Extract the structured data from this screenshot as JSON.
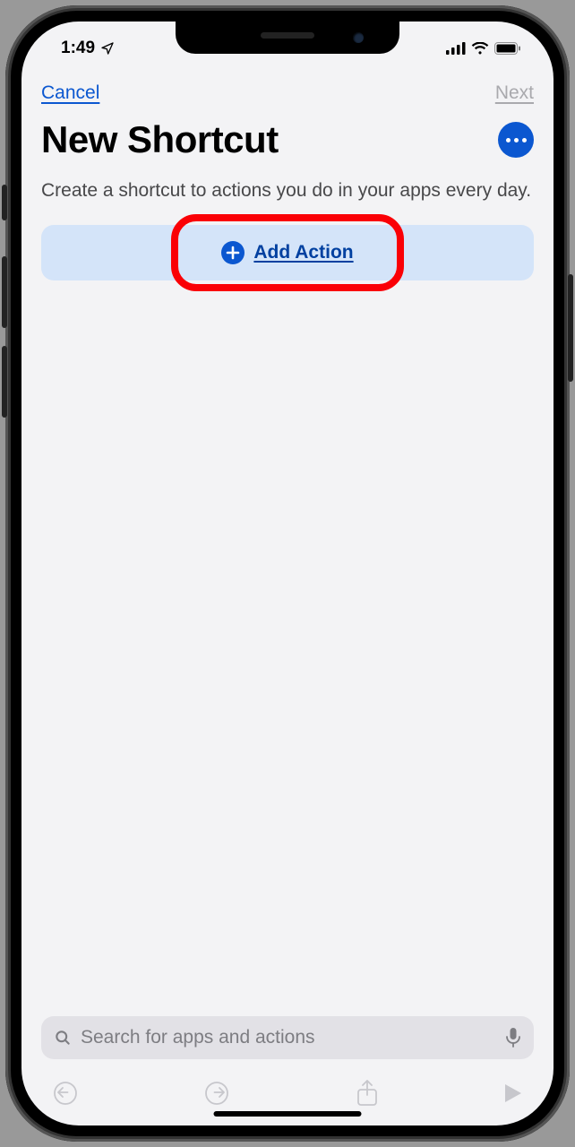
{
  "status": {
    "time": "1:49",
    "location_icon": "location-arrow"
  },
  "nav": {
    "cancel": "Cancel",
    "next": "Next"
  },
  "header": {
    "title": "New Shortcut",
    "subtitle": "Create a shortcut to actions you do in your apps every day."
  },
  "main": {
    "add_action_label": "Add Action"
  },
  "search": {
    "placeholder": "Search for apps and actions"
  },
  "icons": {
    "search": "search-icon",
    "mic": "microphone-icon",
    "undo": "undo-icon",
    "redo": "redo-icon",
    "share": "share-icon",
    "play": "play-icon",
    "more": "ellipsis-icon",
    "plus": "plus-icon",
    "signal": "cellular-signal-icon",
    "wifi": "wifi-icon",
    "battery": "battery-icon"
  }
}
